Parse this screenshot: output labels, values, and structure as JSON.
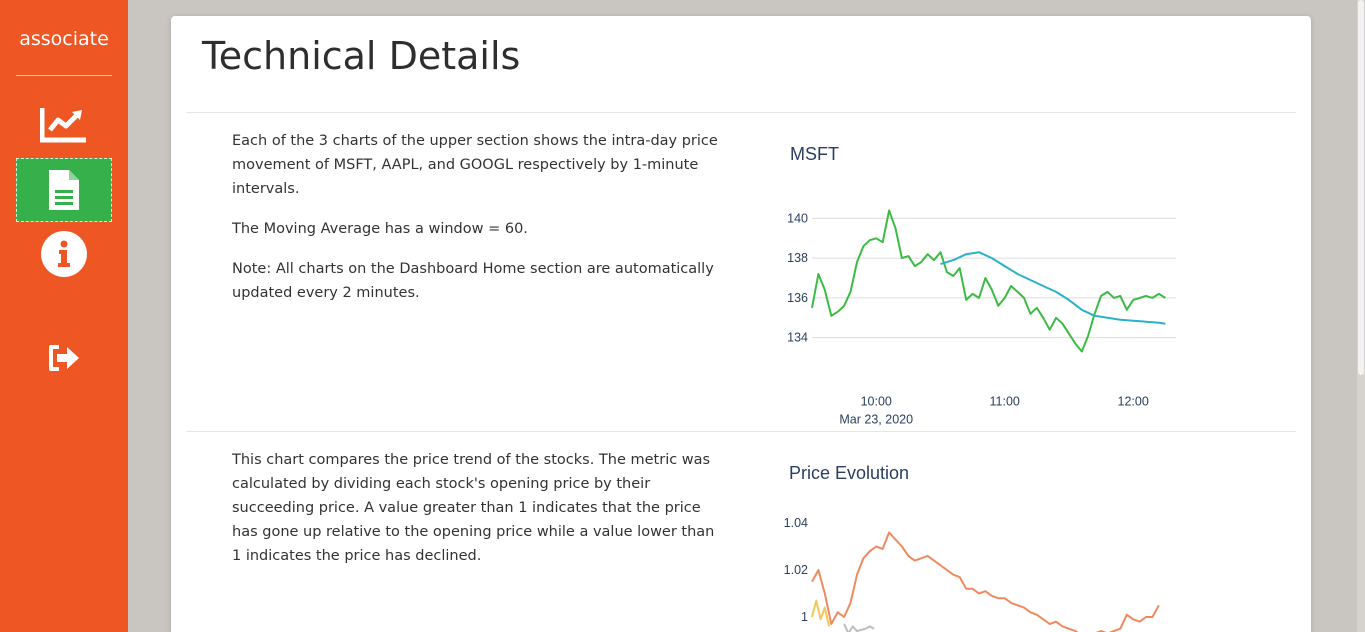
{
  "sidebar": {
    "brand": "associate",
    "nav": [
      {
        "name": "dashboard",
        "icon": "chart-line-icon"
      },
      {
        "name": "technical-details",
        "icon": "document-icon",
        "active": true
      },
      {
        "name": "about",
        "icon": "info-circle-icon"
      },
      {
        "name": "logout",
        "icon": "sign-out-icon"
      }
    ],
    "colors": {
      "background": "#ee5623",
      "active": "#36b04a"
    }
  },
  "page": {
    "title": "Technical Details"
  },
  "sections": [
    {
      "paragraphs": [
        "Each of the 3 charts of the upper section shows the intra-day price movement of MSFT, AAPL, and GOOGL respectively by 1-minute intervals.",
        "The Moving Average has a window = 60.",
        "Note: All charts on the Dashboard Home section are automatically updated every 2 minutes."
      ]
    },
    {
      "paragraphs": [
        "This chart compares the price trend of the stocks. The metric was calculated by dividing each stock's opening price by their succeeding price. A value greater than 1 indicates that the price has gone up relative to the opening price while a value lower than 1 indicates the price has declined."
      ]
    }
  ],
  "chart_data": [
    {
      "type": "line",
      "title": "MSFT",
      "x_ticks": [
        "10:00",
        "11:00",
        "12:00"
      ],
      "x_subtick": "Mar 23, 2020",
      "xlim": [
        "09:30",
        "12:20"
      ],
      "y_ticks": [
        134,
        136,
        138,
        140
      ],
      "ylim": [
        133,
        141
      ],
      "grid": true,
      "series": [
        {
          "color": "#3cba45",
          "x": [
            "09:30",
            "09:33",
            "09:36",
            "09:39",
            "09:42",
            "09:45",
            "09:48",
            "09:51",
            "09:54",
            "09:57",
            "10:00",
            "10:03",
            "10:06",
            "10:09",
            "10:12",
            "10:15",
            "10:18",
            "10:21",
            "10:24",
            "10:27",
            "10:30",
            "10:33",
            "10:36",
            "10:39",
            "10:42",
            "10:45",
            "10:48",
            "10:51",
            "10:54",
            "10:57",
            "11:00",
            "11:03",
            "11:06",
            "11:09",
            "11:12",
            "11:15",
            "11:18",
            "11:21",
            "11:24",
            "11:27",
            "11:30",
            "11:33",
            "11:36",
            "11:39",
            "11:42",
            "11:45",
            "11:48",
            "11:51",
            "11:54",
            "11:57",
            "12:00",
            "12:03",
            "12:06",
            "12:09",
            "12:12",
            "12:15"
          ],
          "y": [
            135.5,
            137.2,
            136.4,
            135.1,
            135.3,
            135.6,
            136.3,
            137.8,
            138.6,
            138.9,
            139.0,
            138.8,
            140.4,
            139.5,
            138.0,
            138.1,
            137.6,
            137.8,
            138.2,
            137.9,
            138.3,
            137.3,
            137.1,
            137.5,
            135.9,
            136.2,
            136.0,
            137.0,
            136.4,
            135.6,
            136.0,
            136.6,
            136.3,
            136.0,
            135.2,
            135.5,
            135.0,
            134.4,
            135.0,
            134.7,
            134.2,
            133.7,
            133.3,
            134.1,
            135.2,
            136.1,
            136.3,
            136.0,
            136.1,
            135.4,
            135.9,
            136.0,
            136.1,
            136.0,
            136.2,
            136.0
          ]
        },
        {
          "color": "#2bb0c9",
          "x": [
            "10:30",
            "10:36",
            "10:42",
            "10:48",
            "10:54",
            "11:00",
            "11:06",
            "11:12",
            "11:18",
            "11:24",
            "11:30",
            "11:36",
            "11:42",
            "11:48",
            "11:54",
            "12:00",
            "12:06",
            "12:12",
            "12:15"
          ],
          "y": [
            137.7,
            137.9,
            138.2,
            138.3,
            138.0,
            137.6,
            137.2,
            136.9,
            136.6,
            136.3,
            135.9,
            135.4,
            135.1,
            135.0,
            134.9,
            134.85,
            134.8,
            134.75,
            134.7
          ]
        }
      ]
    },
    {
      "type": "line",
      "title": "Price Evolution",
      "y_ticks": [
        1,
        1.02,
        1.04
      ],
      "ylim": [
        0.99,
        1.045
      ],
      "grid": false,
      "series": [
        {
          "color": "#f0895e",
          "x": [
            "09:30",
            "09:33",
            "09:36",
            "09:39",
            "09:42",
            "09:45",
            "09:48",
            "09:51",
            "09:54",
            "09:57",
            "10:00",
            "10:03",
            "10:06",
            "10:09",
            "10:12",
            "10:15",
            "10:18",
            "10:21",
            "10:24",
            "10:27",
            "10:30",
            "10:33",
            "10:36",
            "10:39",
            "10:42",
            "10:45",
            "10:48",
            "10:51",
            "10:54",
            "10:57",
            "11:00",
            "11:03",
            "11:06",
            "11:09",
            "11:12",
            "11:15",
            "11:18",
            "11:21",
            "11:24",
            "11:27",
            "11:30",
            "11:33",
            "11:36",
            "11:39",
            "11:42",
            "11:45",
            "11:48",
            "11:51",
            "11:54",
            "11:57",
            "12:00",
            "12:03",
            "12:06",
            "12:09",
            "12:12"
          ],
          "y": [
            1.015,
            1.02,
            1.01,
            0.997,
            1.002,
            1.0,
            1.006,
            1.018,
            1.025,
            1.028,
            1.03,
            1.029,
            1.036,
            1.033,
            1.03,
            1.026,
            1.024,
            1.025,
            1.026,
            1.024,
            1.022,
            1.02,
            1.018,
            1.017,
            1.012,
            1.012,
            1.01,
            1.011,
            1.009,
            1.008,
            1.008,
            1.006,
            1.005,
            1.004,
            1.002,
            1.001,
            0.999,
            0.997,
            0.998,
            0.996,
            0.995,
            0.994,
            0.992,
            0.992,
            0.993,
            0.994,
            0.993,
            0.994,
            0.995,
            1.001,
            0.999,
            0.998,
            1.0,
            1.0,
            1.005
          ]
        },
        {
          "color": "#f2c85b",
          "x": [
            "09:30",
            "09:32",
            "09:34",
            "09:36",
            "09:38"
          ],
          "y": [
            1.0,
            1.007,
            0.999,
            1.004,
            0.996
          ]
        },
        {
          "color": "#bdbdbd",
          "x": [
            "09:45",
            "09:47",
            "09:49",
            "09:51",
            "09:55",
            "09:57",
            "09:59"
          ],
          "y": [
            0.997,
            0.993,
            0.996,
            0.994,
            0.995,
            0.996,
            0.995
          ]
        }
      ]
    }
  ]
}
